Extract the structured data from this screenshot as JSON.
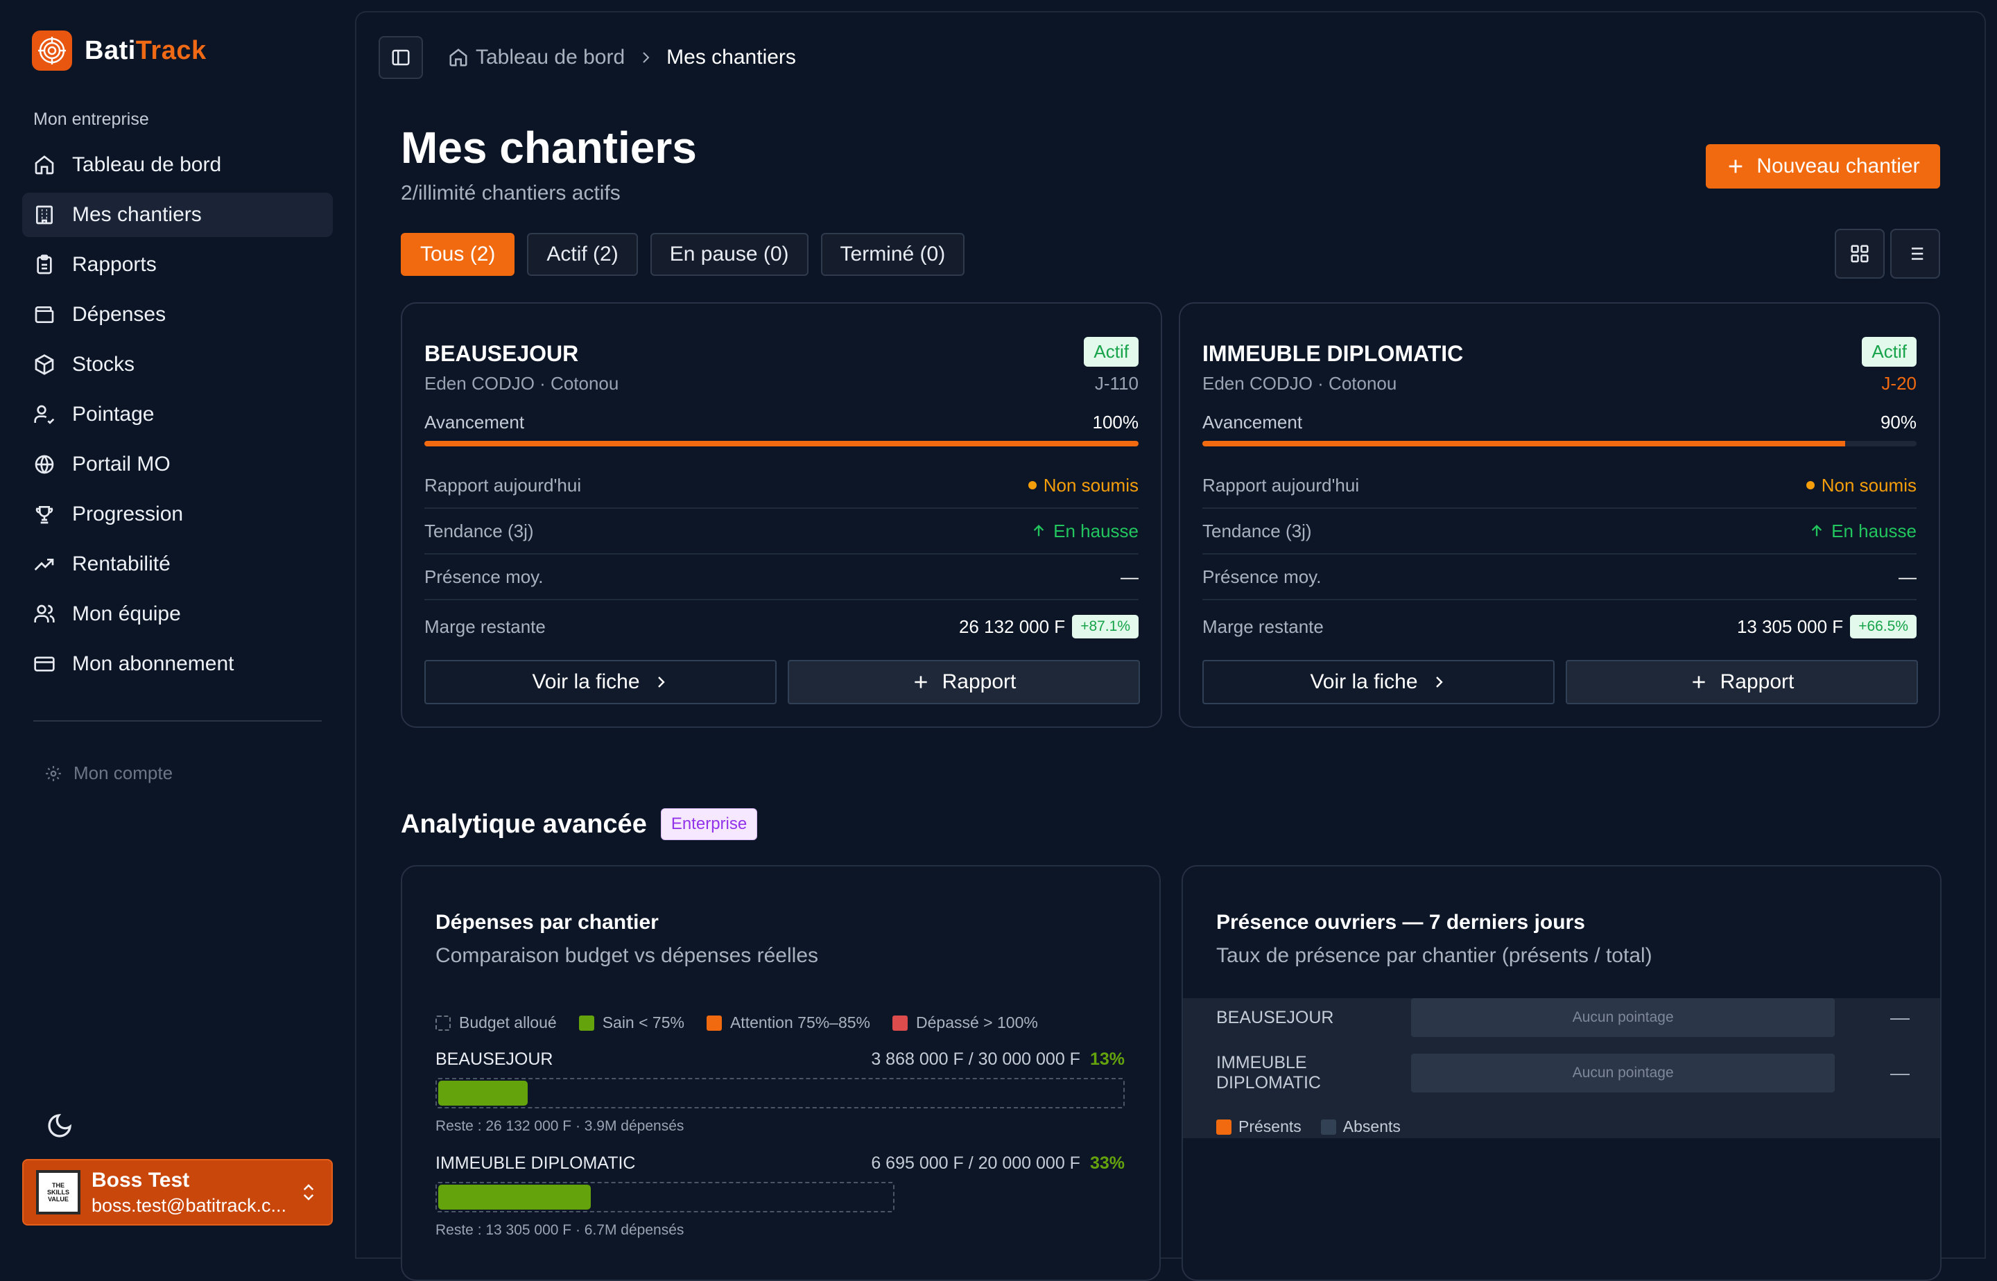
{
  "app": {
    "name_part1": "Bati",
    "name_part2": "Track",
    "accent": "#f26a10"
  },
  "sidebar": {
    "section_label": "Mon entreprise",
    "items": [
      {
        "label": "Tableau de bord",
        "icon": "home-icon"
      },
      {
        "label": "Mes chantiers",
        "icon": "building-icon"
      },
      {
        "label": "Rapports",
        "icon": "clipboard-icon"
      },
      {
        "label": "Dépenses",
        "icon": "wallet-icon"
      },
      {
        "label": "Stocks",
        "icon": "package-icon"
      },
      {
        "label": "Pointage",
        "icon": "user-check-icon"
      },
      {
        "label": "Portail MO",
        "icon": "globe-icon"
      },
      {
        "label": "Progression",
        "icon": "trophy-icon"
      },
      {
        "label": "Rentabilité",
        "icon": "trending-up-icon"
      },
      {
        "label": "Mon équipe",
        "icon": "users-icon"
      },
      {
        "label": "Mon abonnement",
        "icon": "credit-card-icon"
      }
    ],
    "account_label": "Mon compte",
    "user": {
      "name": "Boss Test",
      "email": "boss.test@batitrack.c..."
    }
  },
  "breadcrumb": {
    "home": "Tableau de bord",
    "current": "Mes chantiers"
  },
  "header": {
    "title": "Mes chantiers",
    "subtitle": "2/illimité chantiers actifs",
    "new_button": "Nouveau chantier"
  },
  "filters": [
    "Tous (2)",
    "Actif (2)",
    "En pause (0)",
    "Terminé (0)"
  ],
  "labels": {
    "avancement": "Avancement",
    "rapport": "Rapport aujourd'hui",
    "tendance": "Tendance (3j)",
    "presence": "Présence moy.",
    "marge": "Marge restante",
    "voir": "Voir la fiche",
    "rapport_btn": "Rapport"
  },
  "chantiers": [
    {
      "name": "BEAUSEJOUR",
      "status": "Actif",
      "meta": "Eden CODJO · Cotonou",
      "deadline": "J-110",
      "progress": "100%",
      "rapport": "Non soumis",
      "tendance": "En hausse",
      "presence": "—",
      "marge": "26 132 000 F",
      "marge_pct": "+87.1%"
    },
    {
      "name": "IMMEUBLE DIPLOMATIC",
      "status": "Actif",
      "meta": "Eden CODJO · Cotonou",
      "deadline": "J-20",
      "progress": "90%",
      "rapport": "Non soumis",
      "tendance": "En hausse",
      "presence": "—",
      "marge": "13 305 000 F",
      "marge_pct": "+66.5%"
    }
  ],
  "analytics": {
    "title": "Analytique avancée",
    "badge": "Enterprise",
    "depenses": {
      "title": "Dépenses par chantier",
      "subtitle": "Comparaison budget vs dépenses réelles",
      "legend": [
        "Budget alloué",
        "Sain < 75%",
        "Attention 75%–85%",
        "Dépassé > 100%"
      ],
      "rows": [
        {
          "name": "BEAUSEJOUR",
          "amount": "3 868 000 F / 30 000 000 F",
          "pct": "13%",
          "note": "Reste : 26 132 000 F · 3.9M dépensés"
        },
        {
          "name": "IMMEUBLE DIPLOMATIC",
          "amount": "6 695 000 F / 20 000 000 F",
          "pct": "33%",
          "note": "Reste : 13 305 000 F · 6.7M dépensés"
        }
      ]
    },
    "presence": {
      "title": "Présence ouvriers — 7 derniers jours",
      "subtitle": "Taux de présence par chantier (présents / total)",
      "rows": [
        {
          "name": "BEAUSEJOUR",
          "bar": "Aucun pointage",
          "value": "—"
        },
        {
          "name": "IMMEUBLE DIPLOMATIC",
          "bar": "Aucun pointage",
          "value": "—"
        }
      ],
      "legend": [
        "Présents",
        "Absents"
      ]
    }
  }
}
